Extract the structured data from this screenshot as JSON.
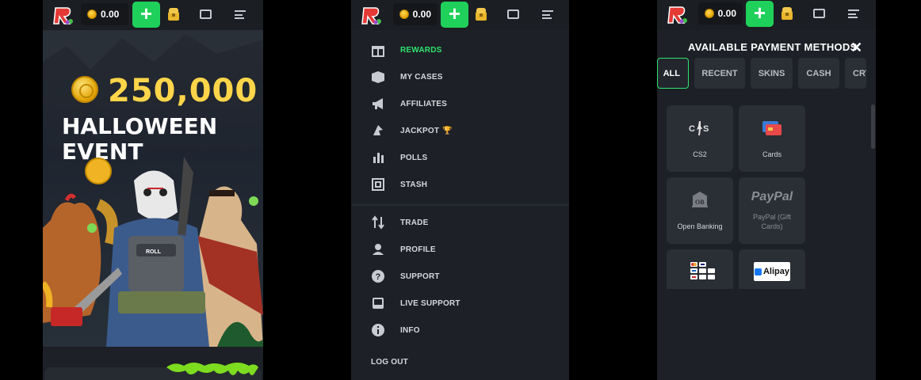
{
  "topbar": {
    "balance": "0.00",
    "deposit_label": "+"
  },
  "banner": {
    "amount": "250,000",
    "title_line1": "HALLOWEEN",
    "title_line2": "EVENT"
  },
  "menu": {
    "items": [
      {
        "label": "REWARDS",
        "icon": "gift-icon",
        "active": true
      },
      {
        "label": "MY CASES",
        "icon": "box-icon"
      },
      {
        "label": "AFFILIATES",
        "icon": "megaphone-icon"
      },
      {
        "label": "JACKPOT",
        "icon": "jackpot-icon"
      },
      {
        "label": "POLLS",
        "icon": "bar-chart-icon"
      },
      {
        "label": "STASH",
        "icon": "stash-icon"
      },
      {
        "label": "TRADE",
        "icon": "trade-arrows-icon"
      },
      {
        "label": "PROFILE",
        "icon": "person-icon"
      },
      {
        "label": "SUPPORT",
        "icon": "question-icon"
      },
      {
        "label": "LIVE SUPPORT",
        "icon": "inbox-icon"
      },
      {
        "label": "INFO",
        "icon": "info-icon"
      },
      {
        "label": "LOG OUT",
        "icon": ""
      }
    ]
  },
  "payments": {
    "header": "AVAILABLE PAYMENT METHODS",
    "close": "✕",
    "tabs": [
      "ALL",
      "RECENT",
      "SKINS",
      "CASH",
      "CRY"
    ],
    "methods": [
      {
        "label": "CS2",
        "icon": "cs2-icon"
      },
      {
        "label": "Cards",
        "icon": "card-icon"
      },
      {
        "label": "Open Banking",
        "icon": "bank-icon"
      },
      {
        "label": "PayPal (Gift Cards)",
        "icon": "paypal-icon",
        "logo_text": "PayPal"
      },
      {
        "label": "",
        "icon": "card-brands-icon"
      },
      {
        "label": "",
        "icon": "alipay-icon",
        "logo_text": "Alipay"
      }
    ]
  },
  "colors": {
    "accent_green": "#1fd15a",
    "gold": "#ffd54a",
    "bg_dark": "#1d2026"
  }
}
